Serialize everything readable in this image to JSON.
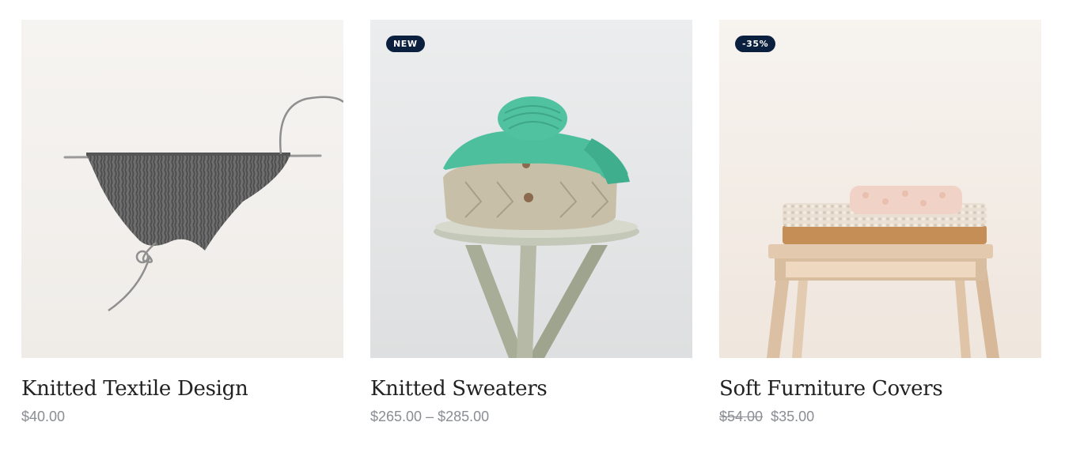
{
  "products": [
    {
      "image_alt": "Knitted Textile Design",
      "title": "Knitted Textile Design",
      "price": "$40.00"
    },
    {
      "badge": "NEW",
      "image_alt": "Knitted Sweaters",
      "title": "Knitted Sweaters",
      "price": "$265.00 – $285.00"
    },
    {
      "badge": "-35%",
      "image_alt": "Soft Furniture Covers",
      "title": "Soft Furniture Covers",
      "old_price": "$54.00",
      "price": "$35.00"
    }
  ],
  "colors": {
    "badge_bg": "#0b1f3f",
    "badge_text": "#ffffff",
    "title": "#222222",
    "price": "#8a8d92"
  }
}
